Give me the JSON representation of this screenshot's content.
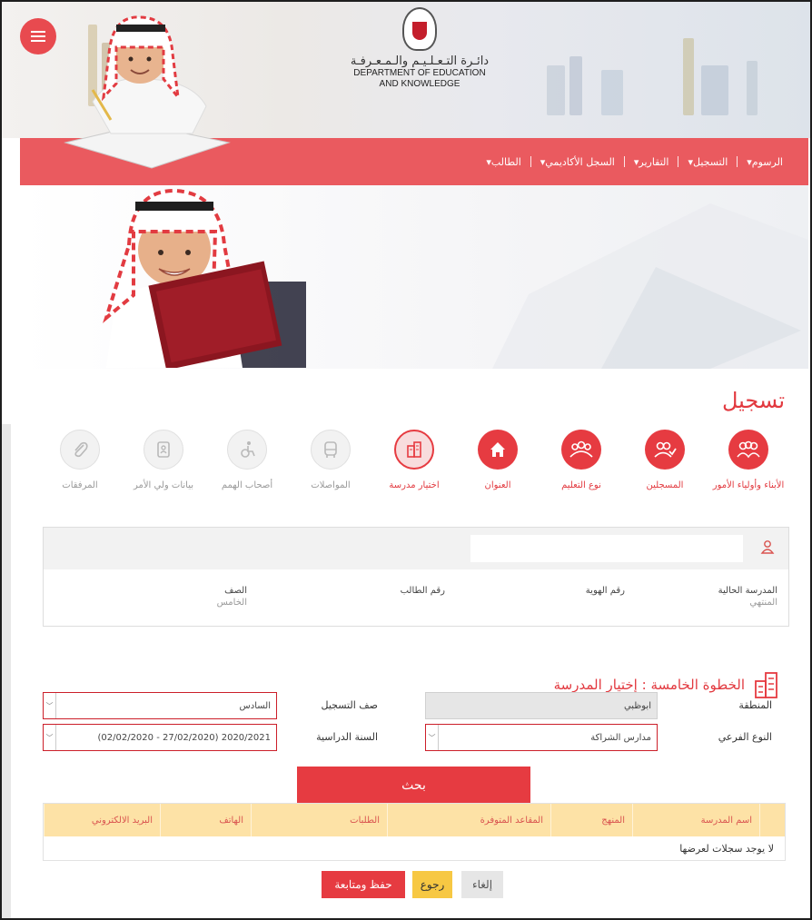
{
  "header": {
    "logo_ar": "دائـرة التـعـلـيـم والـمـعـرفـة",
    "logo_en_1": "DEPARTMENT OF EDUCATION",
    "logo_en_2": "AND KNOWLEDGE"
  },
  "nav": [
    {
      "label": "الطالب▾"
    },
    {
      "label": "السجل الأكاديمي▾"
    },
    {
      "label": "التقارير▾"
    },
    {
      "label": "التسجيل▾"
    },
    {
      "label": "الرسوم▾"
    }
  ],
  "page_title": "تسجيل",
  "steps": [
    {
      "label": "الأبناء وأولياء الأمور",
      "state": "done",
      "icon": "family-icon"
    },
    {
      "label": "المسجلين",
      "state": "done",
      "icon": "users-check-icon"
    },
    {
      "label": "نوع التعليم",
      "state": "done",
      "icon": "group-icon"
    },
    {
      "label": "العنوان",
      "state": "done",
      "icon": "home-icon"
    },
    {
      "label": "اختيار مدرسة",
      "state": "current",
      "icon": "building-icon"
    },
    {
      "label": "المواصلات",
      "state": "todo",
      "icon": "bus-icon"
    },
    {
      "label": "أصحاب الهمم",
      "state": "todo",
      "icon": "wheelchair-icon"
    },
    {
      "label": "بيانات ولي الأمر",
      "state": "todo",
      "icon": "contact-book-icon"
    },
    {
      "label": "المرفقات",
      "state": "todo",
      "icon": "paperclip-icon"
    }
  ],
  "student_card": {
    "search_value": "",
    "columns": [
      {
        "label": "المدرسة الحالية",
        "value": "المنتهي"
      },
      {
        "label": "رقم الهوية",
        "value": ""
      },
      {
        "label": "رقم الطالب",
        "value": ""
      },
      {
        "label": "الصف",
        "value": "الخامس"
      }
    ]
  },
  "section_title": "الخطوة الخامسة : إختيار المدرسة",
  "form": {
    "region_label": "المنطقة",
    "region_value": "ابوظبي",
    "grade_label": "صف التسجيل",
    "grade_value": "السادس",
    "subtype_label": "النوع الفرعي",
    "subtype_value": "مدارس الشراكة",
    "year_label": "السنة الدراسية",
    "year_value": "2020/2021 (27/02/2020 - 02/02/2020)"
  },
  "search_button": "بحث",
  "table": {
    "headers": [
      "اسم المدرسة",
      "المنهج",
      "المقاعد المتوفرة",
      "الطلبات",
      "الهاتف",
      "البريد الالكتروني"
    ],
    "empty_text": "لا يوجد سجلات لعرضها"
  },
  "actions": {
    "save": "حفظ ومتابعة",
    "back": "رجوع",
    "cancel": "إلغاء"
  },
  "colors": {
    "brand_red": "#e63b41",
    "nav_red": "#ea5a5f",
    "table_header": "#fde2a6",
    "back_yellow": "#f7c843"
  }
}
